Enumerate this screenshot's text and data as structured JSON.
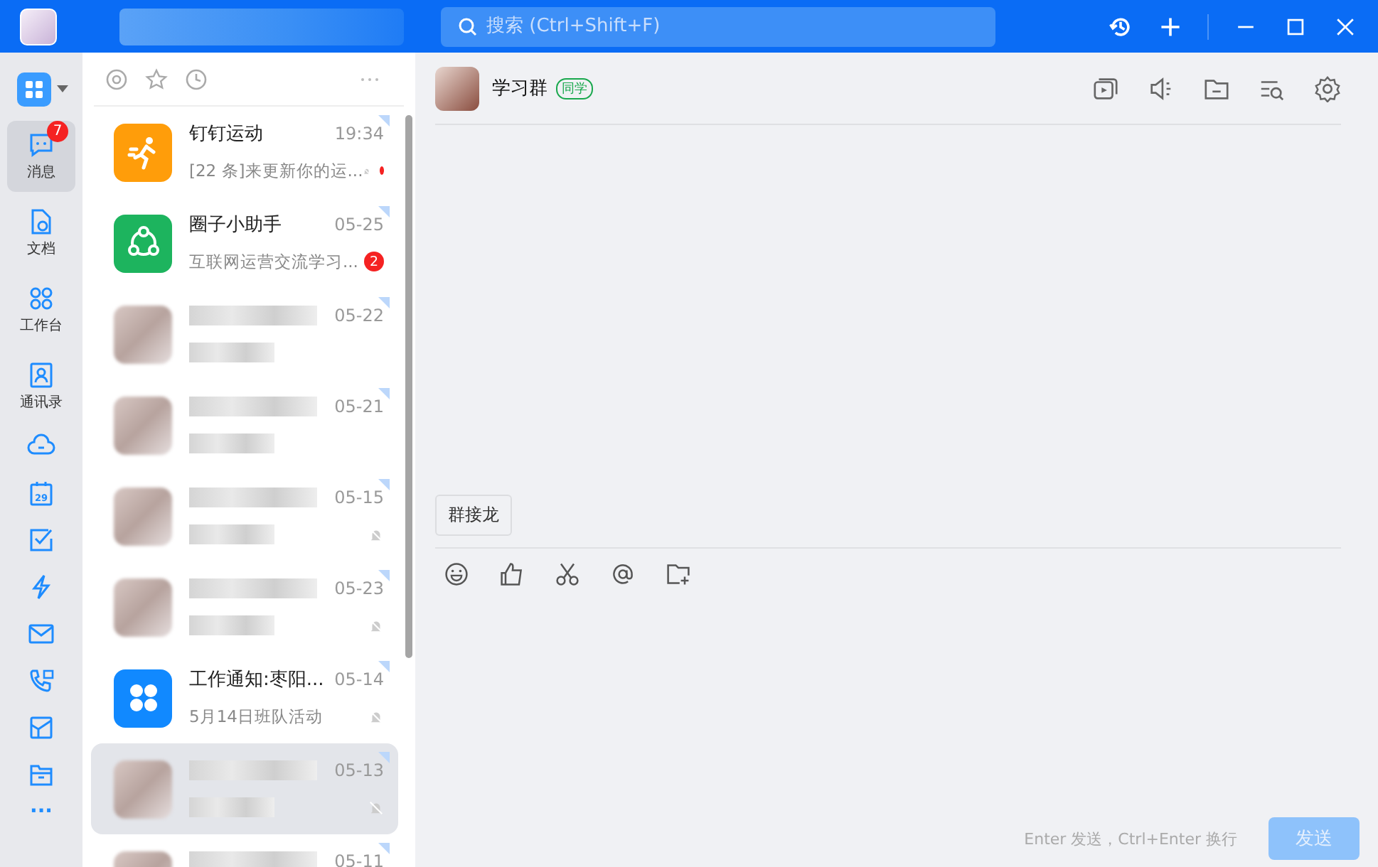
{
  "titlebar": {
    "search": {
      "placeholder": "搜索 (Ctrl+Shift+F)"
    }
  },
  "sidebar": {
    "items": [
      {
        "kind": "labeled",
        "label": "消息",
        "badge": "7",
        "selected": true
      },
      {
        "kind": "labeled",
        "label": "文档",
        "selected": false
      },
      {
        "kind": "labeled",
        "label": "工作台",
        "selected": false
      },
      {
        "kind": "labeled",
        "label": "通讯录",
        "selected": false
      },
      {
        "kind": "icon",
        "selected": false
      },
      {
        "kind": "icon",
        "day": "29",
        "selected": false
      },
      {
        "kind": "icon",
        "selected": false
      },
      {
        "kind": "icon",
        "selected": false
      },
      {
        "kind": "icon",
        "selected": false
      },
      {
        "kind": "icon",
        "selected": false
      },
      {
        "kind": "icon",
        "selected": false
      },
      {
        "kind": "icon",
        "selected": false
      },
      {
        "kind": "more",
        "label": "···",
        "selected": false
      }
    ]
  },
  "chats": [
    {
      "kind": "sport",
      "name": "钉钉运动",
      "time": "19:34",
      "preview": "[22 条]来更新你的运...",
      "muted": true,
      "unread_dot": true,
      "selected": false
    },
    {
      "kind": "circle",
      "name": "圈子小助手",
      "time": "05-25",
      "preview": "互联网运营交流学习...",
      "muted": false,
      "unread": "2",
      "selected": false
    },
    {
      "kind": "blurred",
      "time": "05-22",
      "muted": false,
      "selected": false
    },
    {
      "kind": "blurred",
      "time": "05-21",
      "muted": false,
      "selected": false
    },
    {
      "kind": "blurred",
      "time": "05-15",
      "muted": true,
      "selected": false
    },
    {
      "kind": "blurred",
      "time": "05-23",
      "muted": true,
      "selected": false
    },
    {
      "kind": "notice",
      "name": "工作通知:枣阳...",
      "time": "05-14",
      "preview": "5月14日班队活动",
      "muted": true,
      "selected": false
    },
    {
      "kind": "blurred",
      "time": "05-13",
      "muted": true,
      "selected": true
    },
    {
      "kind": "blurred",
      "time": "05-11",
      "muted": false,
      "selected": false
    }
  ],
  "conversation": {
    "title": "学习群",
    "tag": "同学",
    "quick_actions": [
      "群接龙"
    ],
    "hint": "Enter 发送，Ctrl+Enter 换行",
    "send_button": {
      "label": "发送",
      "disabled": true
    }
  }
}
